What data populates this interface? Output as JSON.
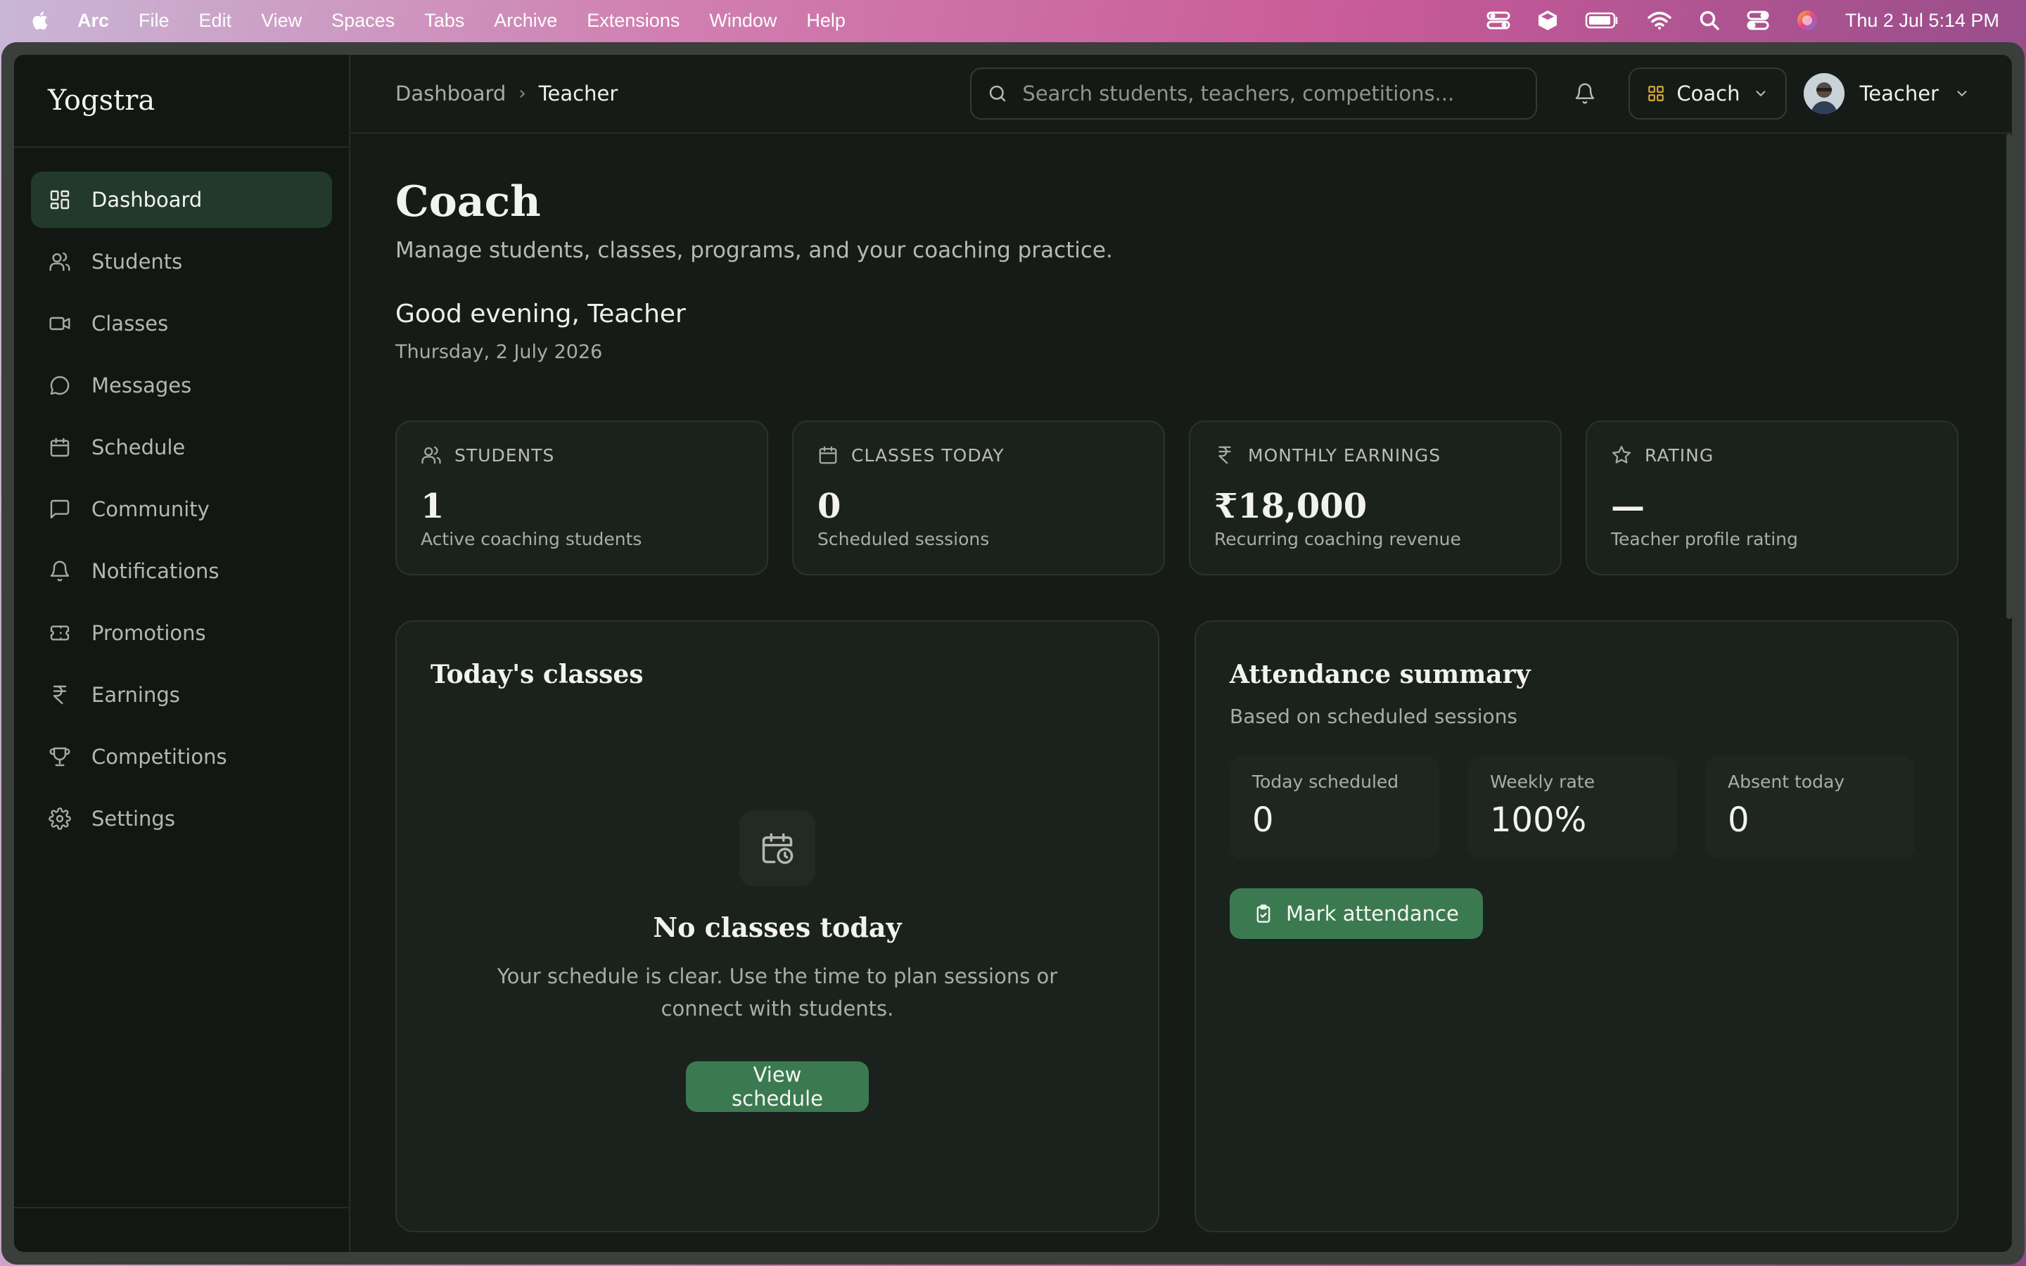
{
  "menubar": {
    "app_name": "Arc",
    "items": [
      "File",
      "Edit",
      "View",
      "Spaces",
      "Tabs",
      "Archive",
      "Extensions",
      "Window",
      "Help"
    ],
    "clock": "Thu 2 Jul  5:14 PM"
  },
  "sidebar": {
    "brand": "Yogstra",
    "items": [
      {
        "label": "Dashboard",
        "icon": "dashboard-icon",
        "active": true
      },
      {
        "label": "Students",
        "icon": "users-icon"
      },
      {
        "label": "Classes",
        "icon": "video-icon"
      },
      {
        "label": "Messages",
        "icon": "chat-bubble-icon"
      },
      {
        "label": "Schedule",
        "icon": "calendar-icon"
      },
      {
        "label": "Community",
        "icon": "message-square-icon"
      },
      {
        "label": "Notifications",
        "icon": "bell-icon"
      },
      {
        "label": "Promotions",
        "icon": "ticket-icon"
      },
      {
        "label": "Earnings",
        "icon": "rupee-icon"
      },
      {
        "label": "Competitions",
        "icon": "trophy-icon"
      },
      {
        "label": "Settings",
        "icon": "gear-icon"
      }
    ]
  },
  "topbar": {
    "breadcrumb": [
      "Dashboard",
      "Teacher"
    ],
    "search_placeholder": "Search students, teachers, competitions...",
    "role": "Coach",
    "user": "Teacher"
  },
  "page": {
    "title": "Coach",
    "subtitle": "Manage students, classes, programs, and your coaching practice.",
    "greeting": "Good evening, Teacher",
    "date": "Thursday, 2 July 2026"
  },
  "stats": [
    {
      "label": "STUDENTS",
      "value": "1",
      "desc": "Active coaching students",
      "icon": "users-icon"
    },
    {
      "label": "CLASSES TODAY",
      "value": "0",
      "desc": "Scheduled sessions",
      "icon": "calendar-icon"
    },
    {
      "label": "MONTHLY EARNINGS",
      "value": "₹18,000",
      "desc": "Recurring coaching revenue",
      "icon": "rupee-icon"
    },
    {
      "label": "RATING",
      "value": "—",
      "desc": "Teacher profile rating",
      "icon": "star-icon"
    }
  ],
  "classes_panel": {
    "title": "Today's classes",
    "empty_title": "No classes today",
    "empty_text": "Your schedule is clear. Use the time to plan sessions or connect with students.",
    "button": "View schedule"
  },
  "attendance_panel": {
    "title": "Attendance summary",
    "subtitle": "Based on scheduled sessions",
    "metrics": [
      {
        "label": "Today scheduled",
        "value": "0"
      },
      {
        "label": "Weekly rate",
        "value": "100%"
      },
      {
        "label": "Absent today",
        "value": "0"
      }
    ],
    "button": "Mark attendance"
  },
  "colors": {
    "accent_green": "#3b7a50",
    "active_nav": "#23392b",
    "background": "#161b18",
    "role_icon": "#d8a93a"
  }
}
